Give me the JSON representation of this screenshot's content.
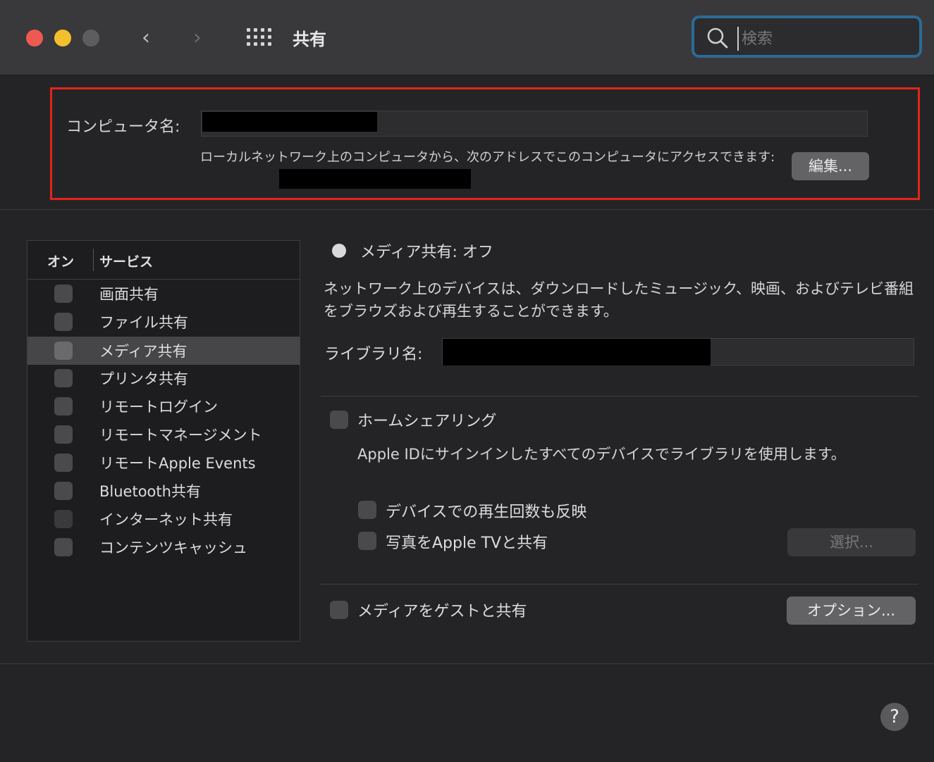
{
  "window": {
    "title": "共有",
    "back_glyph": "‹",
    "forward_glyph": "›"
  },
  "search": {
    "placeholder": "検索",
    "icon": "search-icon"
  },
  "computer_name": {
    "label": "コンピュータ名:",
    "description": "ローカルネットワーク上のコンピュータから、次のアドレスでこのコンピュータにアクセスできます:",
    "edit_button": "編集..."
  },
  "service_list": {
    "col_on": "オン",
    "col_service": "サービス",
    "items": [
      {
        "label": "画面共有",
        "checked": false,
        "selected": false
      },
      {
        "label": "ファイル共有",
        "checked": false,
        "selected": false
      },
      {
        "label": "メディア共有",
        "checked": false,
        "selected": true
      },
      {
        "label": "プリンタ共有",
        "checked": false,
        "selected": false
      },
      {
        "label": "リモートログイン",
        "checked": false,
        "selected": false
      },
      {
        "label": "リモートマネージメント",
        "checked": false,
        "selected": false
      },
      {
        "label": "リモートApple Events",
        "checked": false,
        "selected": false
      },
      {
        "label": "Bluetooth共有",
        "checked": false,
        "selected": false
      },
      {
        "label": "インターネット共有",
        "checked": false,
        "selected": false
      },
      {
        "label": "コンテンツキャッシュ",
        "checked": false,
        "selected": false
      }
    ]
  },
  "media_sharing": {
    "status": "メディア共有: オフ",
    "description": "ネットワーク上のデバイスは、ダウンロードしたミュージック、映画、およびテレビ番組をブラウズおよび再生することができます。",
    "library_label": "ライブラリ名:",
    "home_sharing": {
      "label": "ホームシェアリング",
      "description": "Apple IDにサインインしたすべてのデバイスでライブラリを使用します。",
      "play_count_label": "デバイスでの再生回数も反映",
      "photos_label": "写真をApple TVと共有",
      "select_button": "選択..."
    },
    "guest_label": "メディアをゲストと共有",
    "options_button": "オプション..."
  },
  "help": {
    "label": "?"
  },
  "colors": {
    "accent_focus": "#2d6a96",
    "highlight_border": "#e3241b",
    "close": "#ee5a52",
    "minimize": "#f4bf2f"
  }
}
